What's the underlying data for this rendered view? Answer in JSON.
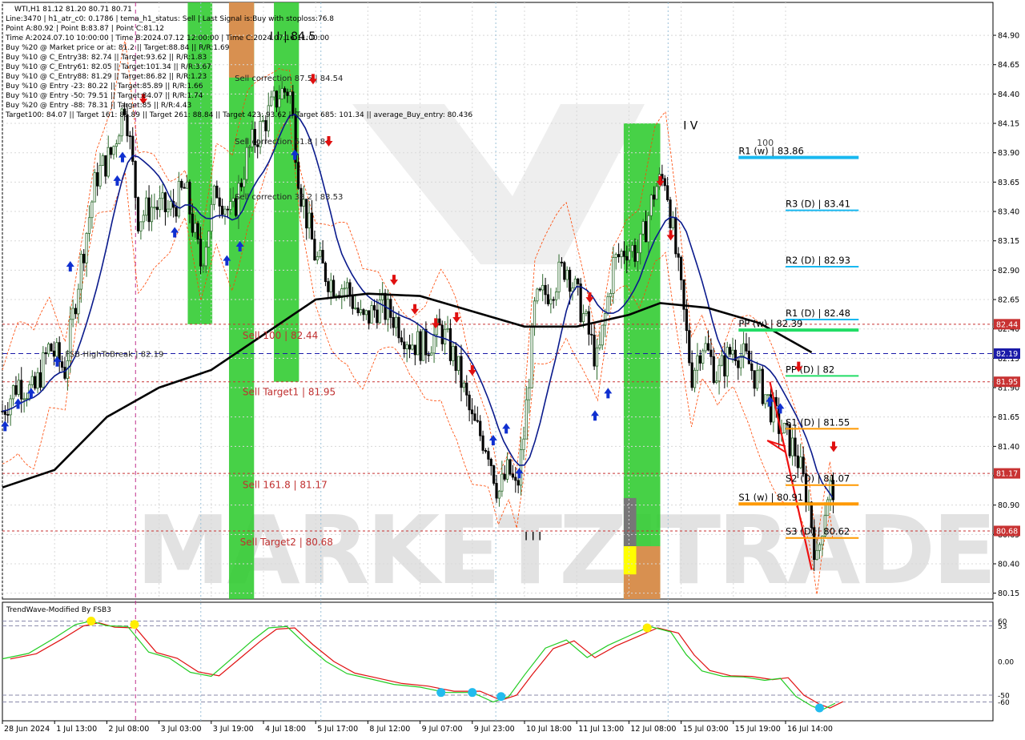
{
  "info_lines": [
    "WTI,H1  81.12 81.20 80.71 80.71",
    "Line:3470 | h1_atr_c0: 0.1786 | tema_h1_status: Sell | Last Signal is:Buy with stoploss:76.8",
    "Point A:80.92 | Point B:83.87 | Point C:81.12",
    "Time A:2024.07.10 10:00:00 | Time B:2024.07.12 12:00:00 | Time C:2024.07.16 11:00:00",
    "Buy %20 @ Market price or at: 81.2 || Target:88.84 || R/R:1.69",
    "Buy %10 @ C_Entry38: 82.74 || Target:93.62 || R/R:1.83",
    "Buy %10 @ C_Entry61: 82.05 || Target:101.34 || R/R:3.67",
    "Buy %10 @ C_Entry88: 81.29 || Target:86.82 || R/R:1.23",
    "Buy %10 @ Entry -23: 80.22 || Target:85.89 || R/R:1.66",
    "Buy %10 @ Entry -50: 79.51 || Target:84.07 || R/R:1.74",
    "Buy %20 @ Entry -88: 78.31 || Target:85 || R/R:4.43",
    "Target100: 84.07 || Target 161: 85.89 || Target 261: 88.84 || Target 423: 93.62 || Target 685: 101.34 || average_Buy_entry: 80.436"
  ],
  "watermark": "MARKETZITRADE",
  "indicator_title": "TrendWave-Modified By FSB3",
  "colors": {
    "bull_candle": "#2e6b2e",
    "bear_candle": "#000000",
    "ma_fast": "#0a1a8c",
    "ma_slow": "#000000",
    "envelope": "#ff4500",
    "level_line": "#b22222",
    "highbreak_line": "#1a1aa8",
    "green_zone": "#33cc33",
    "orange_zone": "#d89050",
    "buy_arrow": "#1030d0",
    "sell_arrow": "#e01010",
    "pivot_cyan": "#18b8f0",
    "pivot_orange": "#ff9900",
    "pivot_green": "#22dd66",
    "oscillator_green": "#22cc22",
    "oscillator_red": "#e01010"
  },
  "zone_labels": [
    {
      "text": "Sell correction 87.5 | 84.54",
      "price": 84.54,
      "x_time": 4.45
    },
    {
      "text": "Sell correction 61.8 | 84",
      "price": 84.0,
      "x_time": 4.45
    },
    {
      "text": "Sell correction 38.2 | 83.53",
      "price": 83.53,
      "x_time": 4.45
    },
    {
      "text": "Sell 100 | 82.44",
      "price": 82.37,
      "x_time": 4.6
    },
    {
      "text": "Sell Target1 | 81.95",
      "price": 81.89,
      "x_time": 4.6
    },
    {
      "text": "Sell 161.8 | 81.17",
      "price": 81.1,
      "x_time": 4.6
    },
    {
      "text": "Sell Target2 | 80.68",
      "price": 80.61,
      "x_time": 4.55
    },
    {
      "text": "FSB-HighToBreak | 82.19",
      "price": 82.19,
      "x_time": 1.2
    }
  ],
  "wave_labels": [
    {
      "text": "I I | 84.5",
      "price": 84.86,
      "x_time": 5.12
    },
    {
      "text": "I V",
      "price": 84.1,
      "x_time": 13.04
    },
    {
      "text": "I I I",
      "price": 80.6,
      "x_time": 10.0
    },
    {
      "text": "100",
      "price": 83.96,
      "x_time": 14.45
    }
  ],
  "pivot_levels": [
    {
      "label": "R1 (w) | 83.86",
      "price": 83.86,
      "color": "cyan",
      "thick": true,
      "from": 14.1,
      "to": 16.4
    },
    {
      "label": "R3 (D) | 83.41",
      "price": 83.41,
      "color": "cyan",
      "thick": false,
      "from": 15.0,
      "to": 16.4
    },
    {
      "label": "R2 (D) | 82.93",
      "price": 82.93,
      "color": "cyan",
      "thick": false,
      "from": 15.0,
      "to": 16.4
    },
    {
      "label": "R1 (D) | 82.48",
      "price": 82.48,
      "color": "cyan",
      "thick": false,
      "from": 15.0,
      "to": 16.4
    },
    {
      "label": "PP (w) | 82.39",
      "price": 82.39,
      "color": "green",
      "thick": true,
      "from": 14.1,
      "to": 16.4
    },
    {
      "label": "PP (D) | 82",
      "price": 82.0,
      "color": "green",
      "thick": false,
      "from": 15.0,
      "to": 16.4
    },
    {
      "label": "S1 (D) | 81.55",
      "price": 81.55,
      "color": "orange",
      "thick": false,
      "from": 15.0,
      "to": 16.4
    },
    {
      "label": "S2 (D) | 81.07",
      "price": 81.07,
      "color": "orange",
      "thick": false,
      "from": 15.0,
      "to": 16.4
    },
    {
      "label": "S1 (w) | 80.91",
      "price": 80.91,
      "color": "orange",
      "thick": true,
      "from": 14.1,
      "to": 16.4
    },
    {
      "label": "S3 (D) | 80.62",
      "price": 80.62,
      "color": "orange",
      "thick": false,
      "from": 15.0,
      "to": 16.4
    }
  ],
  "price_tags": [
    {
      "text": "82.44",
      "price": 82.44,
      "color": "#c83232"
    },
    {
      "text": "82.19",
      "price": 82.19,
      "color": "#1a1aa8"
    },
    {
      "text": "81.95",
      "price": 81.95,
      "color": "#c83232"
    },
    {
      "text": "81.17",
      "price": 81.17,
      "color": "#c83232"
    },
    {
      "text": "80.68",
      "price": 80.68,
      "color": "#c83232"
    }
  ],
  "chart_data": [
    {
      "type": "candlestick",
      "title": "WTI,H1",
      "x_tick_labels": [
        "28 Jun 2024",
        "1 Jul 13:00",
        "2 Jul 08:00",
        "3 Jul 03:00",
        "3 Jul 19:00",
        "4 Jul 18:00",
        "5 Jul 17:00",
        "8 Jul 12:00",
        "9 Jul 07:00",
        "9 Jul 23:00",
        "10 Jul 18:00",
        "11 Jul 13:00",
        "12 Jul 08:00",
        "15 Jul 03:00",
        "15 Jul 19:00",
        "16 Jul 14:00"
      ],
      "y_tick_labels": [
        "84.90",
        "84.65",
        "84.40",
        "84.15",
        "83.90",
        "83.65",
        "83.40",
        "83.15",
        "82.90",
        "82.65",
        "82.40",
        "82.15",
        "81.90",
        "81.65",
        "81.40",
        "81.15",
        "80.90",
        "80.65",
        "80.40",
        "80.15"
      ],
      "ylim": [
        80.1,
        85.18
      ],
      "grid": true,
      "close_path": [
        [
          0.0,
          81.7
        ],
        [
          0.3,
          81.95
        ],
        [
          0.6,
          81.85
        ],
        [
          0.9,
          82.25
        ],
        [
          1.2,
          82.05
        ],
        [
          1.5,
          82.95
        ],
        [
          1.8,
          83.7
        ],
        [
          2.1,
          83.9
        ],
        [
          2.35,
          84.35
        ],
        [
          2.6,
          83.35
        ],
        [
          2.9,
          83.45
        ],
        [
          3.2,
          83.4
        ],
        [
          3.5,
          83.6
        ],
        [
          3.8,
          82.95
        ],
        [
          4.1,
          83.6
        ],
        [
          4.4,
          83.35
        ],
        [
          4.7,
          83.9
        ],
        [
          5.0,
          84.15
        ],
        [
          5.3,
          84.4
        ],
        [
          5.5,
          84.45
        ],
        [
          5.7,
          83.6
        ],
        [
          6.0,
          83.0
        ],
        [
          6.3,
          82.8
        ],
        [
          6.6,
          82.75
        ],
        [
          6.9,
          82.45
        ],
        [
          7.2,
          82.6
        ],
        [
          7.5,
          82.5
        ],
        [
          7.8,
          82.3
        ],
        [
          8.1,
          82.25
        ],
        [
          8.4,
          82.4
        ],
        [
          8.7,
          82.1
        ],
        [
          9.0,
          81.6
        ],
        [
          9.3,
          81.4
        ],
        [
          9.5,
          81.0
        ],
        [
          9.7,
          81.2
        ],
        [
          9.85,
          81.0
        ],
        [
          10.0,
          81.55
        ],
        [
          10.2,
          82.6
        ],
        [
          10.5,
          82.75
        ],
        [
          10.8,
          82.95
        ],
        [
          11.1,
          82.55
        ],
        [
          11.4,
          82.1
        ],
        [
          11.7,
          82.95
        ],
        [
          11.95,
          83.1
        ],
        [
          12.2,
          83.05
        ],
        [
          12.5,
          83.6
        ],
        [
          12.7,
          83.7
        ],
        [
          12.85,
          83.2
        ],
        [
          13.0,
          82.7
        ],
        [
          13.2,
          82.0
        ],
        [
          13.4,
          82.3
        ],
        [
          13.7,
          82.0
        ],
        [
          14.0,
          82.25
        ],
        [
          14.3,
          82.1
        ],
        [
          14.6,
          81.85
        ],
        [
          14.9,
          81.55
        ],
        [
          15.2,
          81.35
        ],
        [
          15.45,
          80.9
        ],
        [
          15.6,
          80.4
        ],
        [
          15.72,
          80.8
        ],
        [
          15.85,
          81.1
        ],
        [
          15.95,
          80.71
        ]
      ],
      "buy_arrows": [
        [
          0.05,
          81.57
        ],
        [
          0.3,
          81.76
        ],
        [
          0.55,
          81.85
        ],
        [
          1.05,
          82.12
        ],
        [
          1.3,
          82.93
        ],
        [
          2.2,
          83.66
        ],
        [
          2.3,
          83.86
        ],
        [
          3.3,
          83.22
        ],
        [
          4.3,
          82.98
        ],
        [
          4.55,
          83.1
        ],
        [
          5.6,
          83.88
        ],
        [
          9.4,
          81.45
        ],
        [
          9.65,
          81.55
        ],
        [
          9.9,
          81.17
        ],
        [
          11.35,
          81.66
        ],
        [
          11.6,
          81.85
        ],
        [
          14.7,
          81.78
        ],
        [
          14.9,
          81.72
        ]
      ],
      "sell_arrows": [
        [
          2.7,
          84.36
        ],
        [
          5.95,
          84.53
        ],
        [
          6.25,
          84.0
        ],
        [
          7.5,
          82.82
        ],
        [
          7.9,
          82.57
        ],
        [
          8.3,
          82.45
        ],
        [
          8.7,
          82.5
        ],
        [
          9.0,
          82.05
        ],
        [
          11.25,
          82.67
        ],
        [
          12.6,
          83.66
        ],
        [
          12.8,
          83.2
        ],
        [
          15.25,
          82.08
        ],
        [
          15.92,
          81.4
        ]
      ],
      "green_zones": [
        [
          3.55,
          4.02,
          82.44,
          85.18
        ],
        [
          4.34,
          4.82,
          80.1,
          85.18
        ],
        [
          5.2,
          5.68,
          81.95,
          85.18
        ],
        [
          11.9,
          12.6,
          80.1,
          84.15
        ]
      ],
      "orange_zones": [
        [
          4.34,
          4.82,
          84.54,
          85.18
        ],
        [
          11.9,
          12.6,
          80.1,
          80.55
        ]
      ],
      "yellow_zone": [
        11.9,
        12.14,
        80.31,
        80.55
      ],
      "gray_zone": [
        11.9,
        12.14,
        80.55,
        80.96
      ]
    },
    {
      "type": "line",
      "title": "TrendWave-Modified By FSB3",
      "y_tick_labels": [
        "60",
        "53",
        "0.00",
        "-50",
        "-60"
      ],
      "ylim": [
        -88,
        88
      ],
      "reference_lines": [
        60,
        53,
        -50,
        -60
      ],
      "series": [
        {
          "values": [
            [
              0.0,
              4
            ],
            [
              0.5,
              12
            ],
            [
              1.0,
              35
            ],
            [
              1.4,
              55
            ],
            [
              1.7,
              60
            ],
            [
              2.0,
              53
            ],
            [
              2.4,
              52
            ],
            [
              2.8,
              14
            ],
            [
              3.2,
              5
            ],
            [
              3.6,
              -16
            ],
            [
              4.0,
              -22
            ],
            [
              4.4,
              5
            ],
            [
              4.8,
              32
            ],
            [
              5.1,
              50
            ],
            [
              5.45,
              52
            ],
            [
              5.8,
              26
            ],
            [
              6.2,
              0
            ],
            [
              6.6,
              -18
            ],
            [
              7.0,
              -25
            ],
            [
              7.5,
              -34
            ],
            [
              8.0,
              -38
            ],
            [
              8.5,
              -46
            ],
            [
              9.0,
              -46
            ],
            [
              9.4,
              -60
            ],
            [
              9.7,
              -52
            ],
            [
              10.0,
              -20
            ],
            [
              10.4,
              20
            ],
            [
              10.8,
              32
            ],
            [
              11.2,
              6
            ],
            [
              11.6,
              24
            ],
            [
              12.0,
              38
            ],
            [
              12.4,
              52
            ],
            [
              12.8,
              44
            ],
            [
              13.1,
              10
            ],
            [
              13.4,
              -14
            ],
            [
              13.8,
              -22
            ],
            [
              14.2,
              -23
            ],
            [
              14.6,
              -28
            ],
            [
              14.9,
              -25
            ],
            [
              15.2,
              -52
            ],
            [
              15.5,
              -66
            ],
            [
              15.7,
              -72
            ],
            [
              15.95,
              -62
            ]
          ]
        }
      ],
      "markers": [
        [
          1.7,
          60,
          "yellow"
        ],
        [
          2.53,
          55,
          "yellow"
        ],
        [
          8.4,
          -46,
          "cyan"
        ],
        [
          9.0,
          -46,
          "cyan"
        ],
        [
          9.55,
          -52,
          "cyan"
        ],
        [
          12.35,
          50,
          "yellow"
        ],
        [
          15.65,
          -69,
          "cyan"
        ]
      ]
    }
  ]
}
